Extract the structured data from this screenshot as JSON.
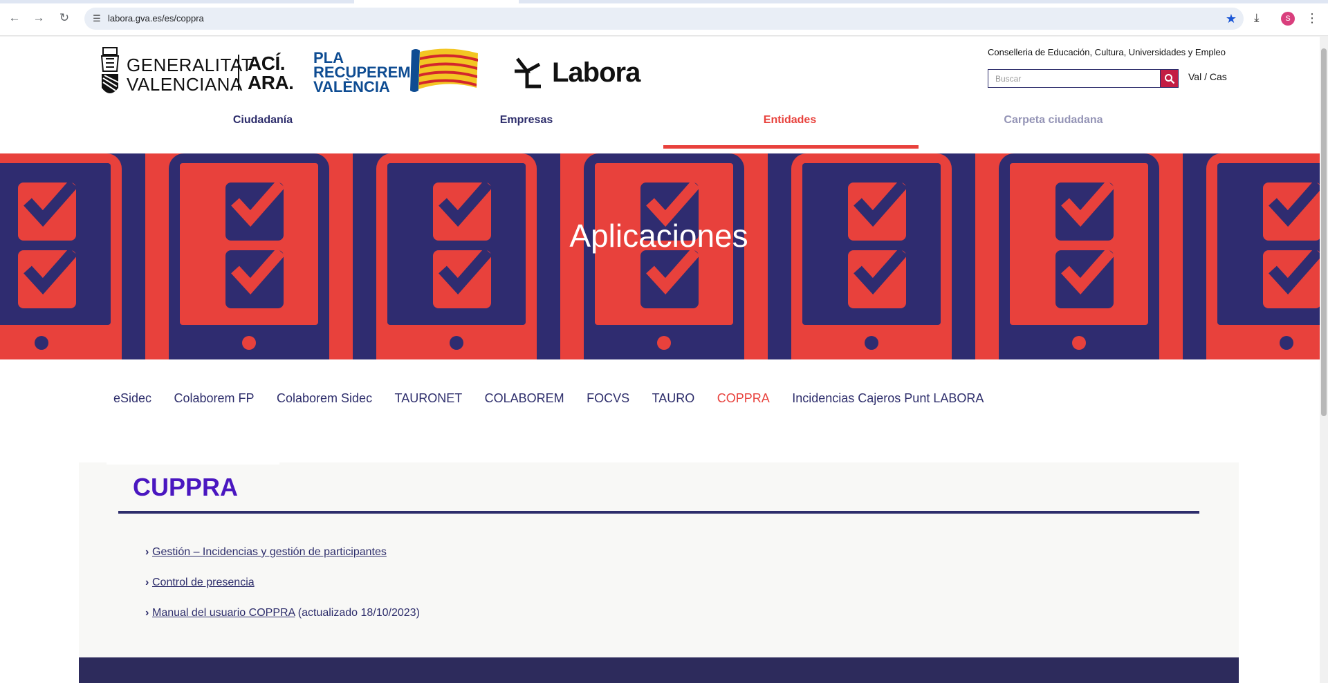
{
  "browser": {
    "url": "labora.gva.es/es/coppra",
    "profile_initial": "S"
  },
  "header": {
    "gva_logo_line1": "GENERALITAT",
    "gva_logo_line2": "VALENCIANA",
    "gva_aci": "ACÍ.",
    "gva_ara": "ARA.",
    "pla_line1": "PLA",
    "pla_line2": "RECUPEREM",
    "pla_line3": "VALÈNCIA",
    "labora_word": "Labora",
    "conselleria": "Conselleria de Educación, Cultura, Universidades y Empleo",
    "search_placeholder": "Buscar",
    "lang_toggle": "Val / Cas"
  },
  "main_nav": [
    {
      "label": "Ciudadanía"
    },
    {
      "label": "Empresas"
    },
    {
      "label": "Entidades"
    },
    {
      "label": "Carpeta ciudadana"
    }
  ],
  "banner": {
    "title": "Aplicaciones"
  },
  "sub_nav": [
    {
      "label": "eSidec"
    },
    {
      "label": "Colaborem FP"
    },
    {
      "label": "Colaborem Sidec"
    },
    {
      "label": "TAURONET"
    },
    {
      "label": "COLABOREM"
    },
    {
      "label": "FOCVS"
    },
    {
      "label": "TAURO"
    },
    {
      "label": "COPPRA"
    },
    {
      "label": "Incidencias Cajeros Punt LABORA"
    }
  ],
  "panel": {
    "title": "CUPPRA",
    "links": [
      {
        "label": "Gestión – Incidencias y gestión de participantes",
        "note": ""
      },
      {
        "label": "Control de presencia",
        "note": ""
      },
      {
        "label": "Manual del usuario COPPRA",
        "note": " (actualizado 18/10/2023)"
      }
    ]
  },
  "colors": {
    "brand_navy": "#2d2d6b",
    "brand_red": "#e8413c",
    "title_purple": "#4a17c0"
  }
}
